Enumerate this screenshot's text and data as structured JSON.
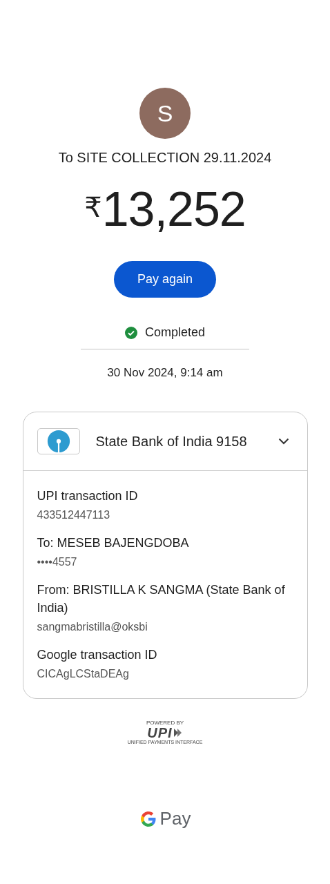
{
  "payee": {
    "initial": "S",
    "title": "To SITE COLLECTION 29.11.2024"
  },
  "amount": {
    "currency": "₹",
    "value": "13,252"
  },
  "pay_again_button": "Pay again",
  "status": {
    "kind": "completed",
    "label": "Completed"
  },
  "datetime": "30 Nov 2024, 9:14 am",
  "account_card": {
    "bank": "State Bank of India 9158",
    "expanded": true,
    "details": [
      {
        "label": "UPI transaction ID",
        "value": "433512447113"
      },
      {
        "label": "To: MESEB BAJENGDOBA",
        "value": "••••4557"
      },
      {
        "label": "From: BRISTILLA K SANGMA (State Bank of India)",
        "value": "sangmabristilla@oksbi"
      },
      {
        "label": "Google transaction ID",
        "value": "CICAgLCStaDEAg"
      }
    ]
  },
  "upi_badge": {
    "top": "POWERED BY",
    "mark": "UPI",
    "bottom": "UNIFIED PAYMENTS INTERFACE"
  },
  "footer_brand": "Pay"
}
